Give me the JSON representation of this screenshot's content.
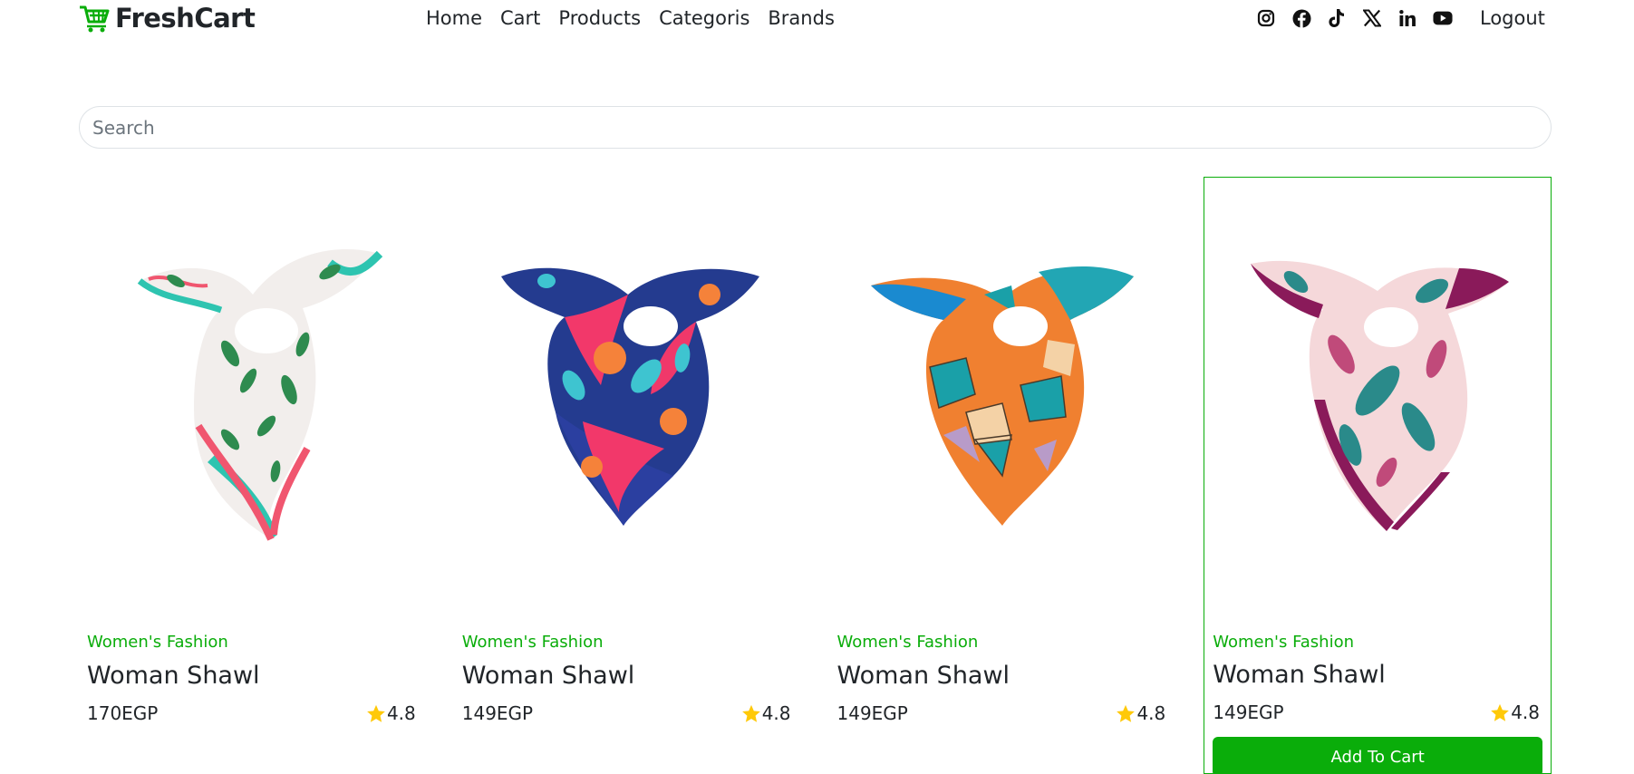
{
  "brand": {
    "name": "FreshCart",
    "icon": "cart-icon",
    "color": "#0aad0a"
  },
  "nav": {
    "links": [
      "Home",
      "Cart",
      "Products",
      "Categoris",
      "Brands"
    ],
    "logout": "Logout",
    "social_icons": [
      "instagram-icon",
      "facebook-icon",
      "tiktok-icon",
      "x-icon",
      "linkedin-icon",
      "youtube-icon"
    ]
  },
  "search": {
    "placeholder": "Search",
    "value": ""
  },
  "products": [
    {
      "category": "Women's Fashion",
      "title": "Woman Shawl",
      "price": "170EGP",
      "rating": "4.8"
    },
    {
      "category": "Women's Fashion",
      "title": "Woman Shawl",
      "price": "149EGP",
      "rating": "4.8"
    },
    {
      "category": "Women's Fashion",
      "title": "Woman Shawl",
      "price": "149EGP",
      "rating": "4.8"
    },
    {
      "category": "Women's Fashion",
      "title": "Woman Shawl",
      "price": "149EGP",
      "rating": "4.8"
    }
  ],
  "add_to_cart_label": "Add To Cart",
  "colors": {
    "accent": "#0aad0a",
    "star": "#ffc908"
  }
}
